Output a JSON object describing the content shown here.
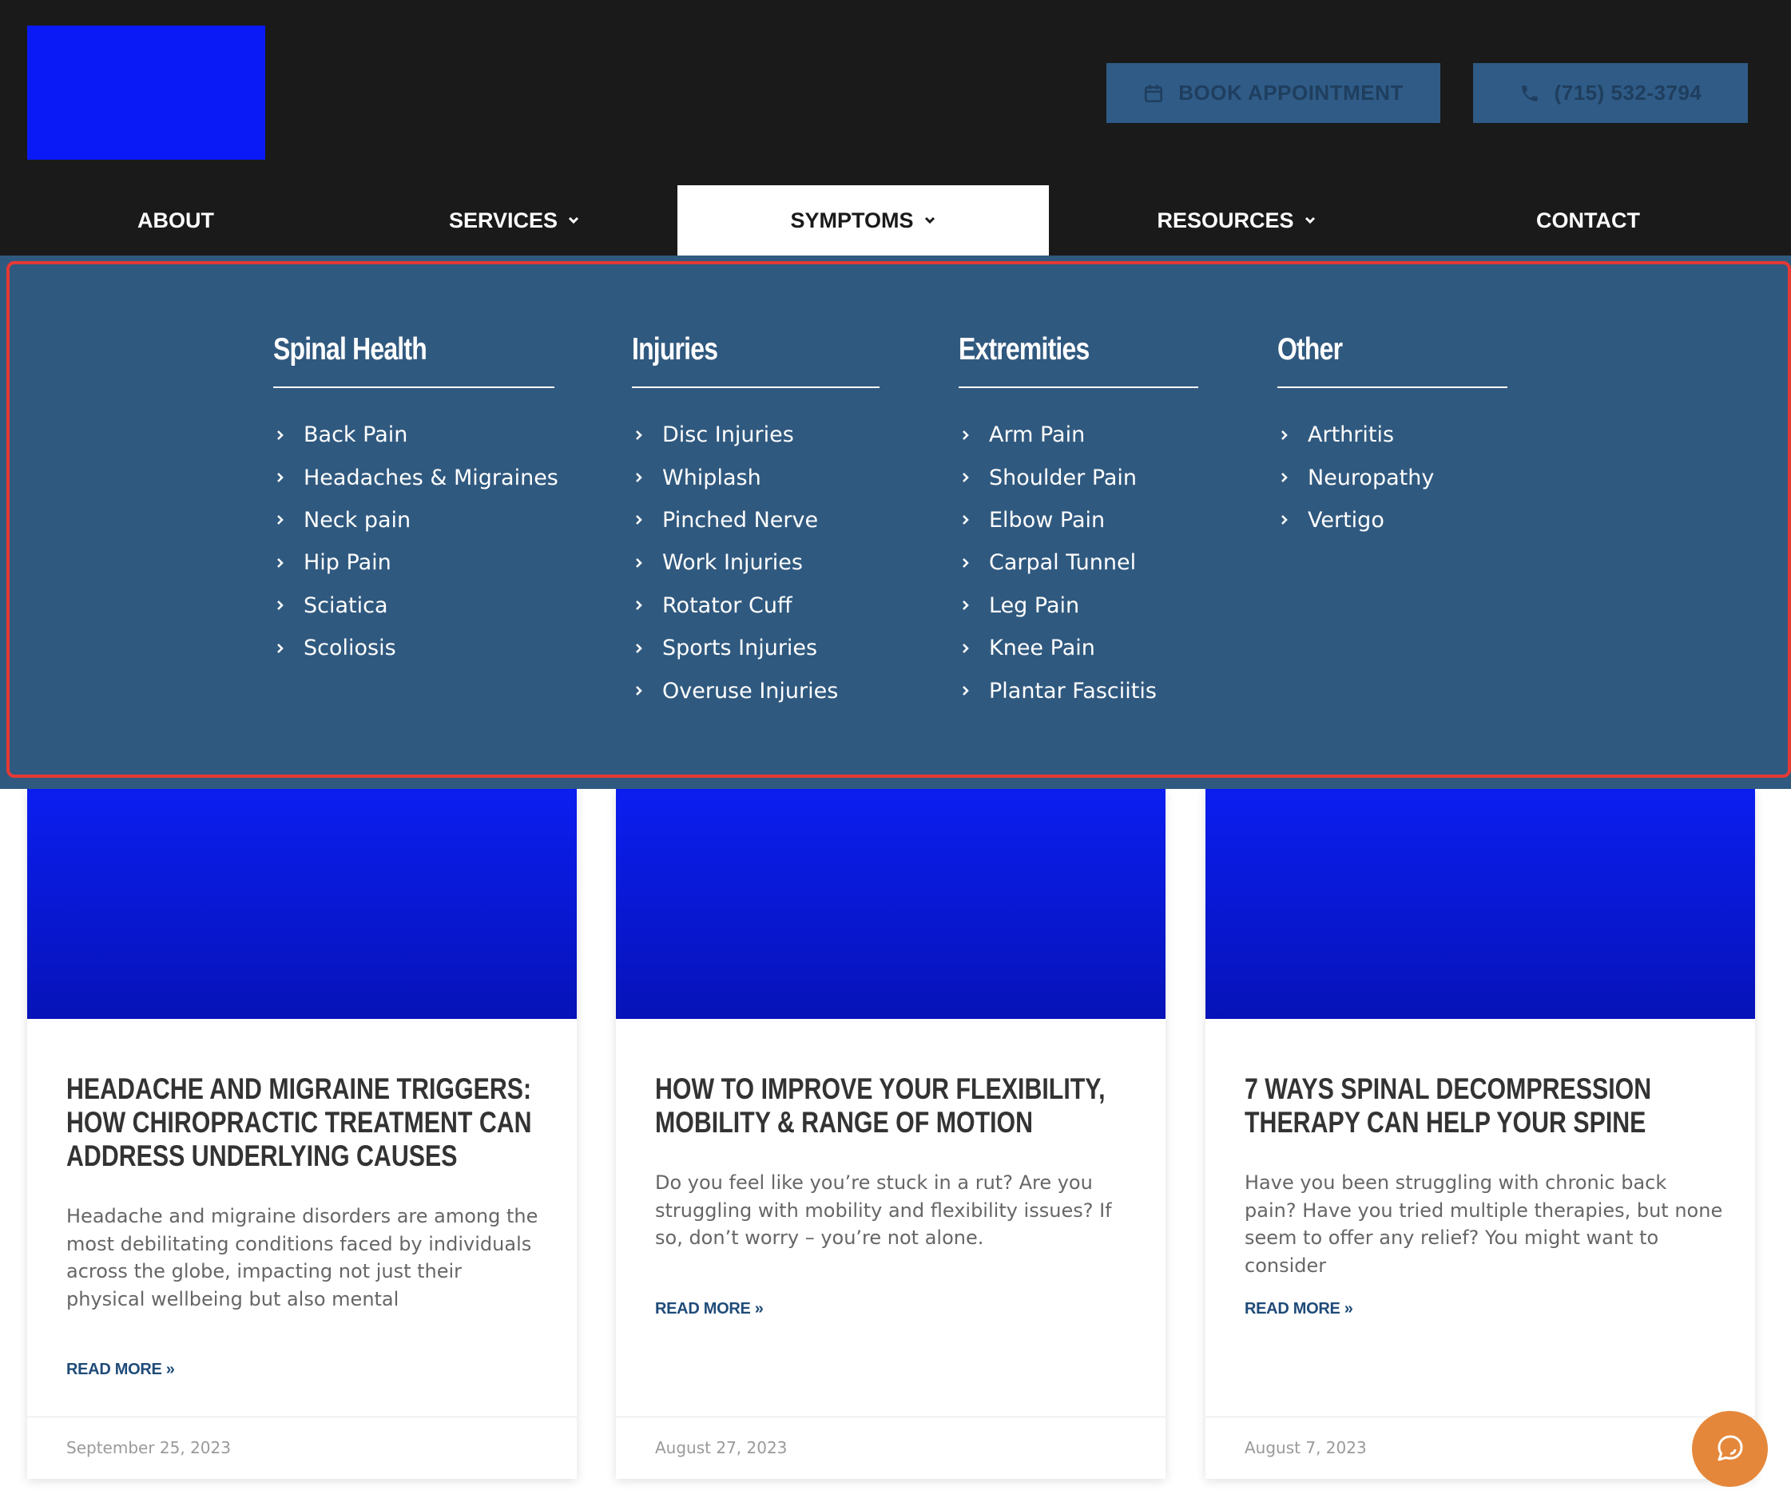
{
  "header": {
    "book_label": "BOOK APPOINTMENT",
    "phone_label": "(715) 532-3794",
    "book_icon": "calendar-icon",
    "phone_icon": "phone-icon"
  },
  "nav": {
    "items": [
      {
        "label": "ABOUT"
      },
      {
        "label": "SERVICES"
      },
      {
        "label": "SYMPTOMS"
      },
      {
        "label": "RESOURCES"
      },
      {
        "label": "CONTACT"
      }
    ],
    "active": "SYMPTOMS"
  },
  "mega": {
    "columns": [
      {
        "title": "Spinal Health",
        "items": [
          "Back Pain",
          "Headaches & Migraines",
          "Neck pain",
          "Hip Pain",
          "Sciatica",
          "Scoliosis"
        ]
      },
      {
        "title": "Injuries",
        "items": [
          "Disc Injuries",
          "Whiplash",
          "Pinched Nerve",
          "Work Injuries",
          "Rotator Cuff",
          "Sports Injuries",
          "Overuse Injuries"
        ]
      },
      {
        "title": "Extremities",
        "items": [
          "Arm Pain",
          "Shoulder Pain",
          "Elbow Pain",
          "Carpal Tunnel",
          "Leg Pain",
          "Knee Pain",
          "Plantar Fasciitis"
        ]
      },
      {
        "title": "Other",
        "items": [
          "Arthritis",
          "Neuropathy",
          "Vertigo"
        ]
      }
    ]
  },
  "posts": [
    {
      "title": "Headache and Migraine Triggers: How Chiropractic Treatment Can Address Underlying Causes",
      "excerpt": "Headache and migraine disorders are among the most debilitating conditions faced by individuals across the globe, impacting not just their physical wellbeing but also mental",
      "more": "READ MORE »",
      "date": "September 25, 2023"
    },
    {
      "title": "How to Improve Your Flexibility, Mobility & Range of Motion",
      "excerpt": "Do you feel like you’re stuck in a rut? Are you struggling with mobility and flexibility issues? If so, don’t worry – you’re not alone.",
      "more": "READ MORE »",
      "date": "August 27, 2023"
    },
    {
      "title": "7 Ways Spinal Decompression Therapy Can Help Your Spine",
      "excerpt": "Have you been struggling with chronic back pain? Have you tried multiple therapies, but none seem to offer any relief? You might want to consider",
      "more": "READ MORE »",
      "date": "August 7, 2023"
    }
  ],
  "colors": {
    "header_bg": "#1a1a1a",
    "logo": "#0a1af7",
    "menu_bg": "#30597f",
    "highlight_outline": "#e53935",
    "accent_link": "#1f4b78",
    "chat_button": "#e5873a"
  },
  "chat": {
    "icon": "chat-bubble-icon"
  }
}
